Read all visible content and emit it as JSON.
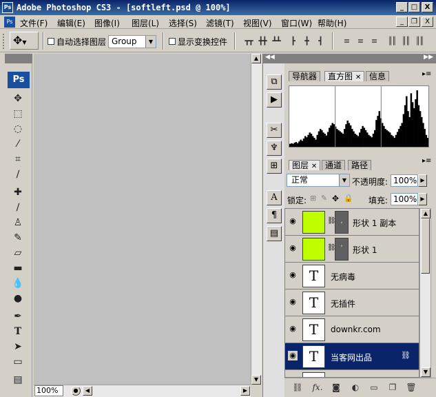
{
  "window": {
    "ps_badge": "Ps",
    "title": "Adobe Photoshop CS3 - [softleft.psd @ 100%]",
    "min_label": "_",
    "max_label": "□",
    "close_label": "X"
  },
  "menu": {
    "items": [
      "文件(F)",
      "编辑(E)",
      "图像(I)",
      "图层(L)",
      "选择(S)",
      "滤镜(T)",
      "视图(V)",
      "窗口(W)",
      "帮助(H)"
    ],
    "doc_min": "_",
    "doc_restore": "❐",
    "doc_close": "X"
  },
  "options": {
    "auto_select_label": "自动选择图层",
    "group_value": "Group",
    "show_transform_label": "显示变换控件"
  },
  "toolbox": {
    "logo": "Ps"
  },
  "document": {
    "zoom": "100%"
  },
  "panels": {
    "top_tabs": [
      "导航器",
      "直方图",
      "信息"
    ],
    "layer_tabs": [
      "图层",
      "通道",
      "路径"
    ],
    "blend_mode": "正常",
    "opacity_label": "不透明度:",
    "opacity_value": "100%",
    "lock_label": "锁定:",
    "fill_label": "填充:",
    "fill_value": "100%",
    "layers": [
      {
        "name": "形状 1 副本",
        "type": "shape",
        "selected": false
      },
      {
        "name": "形状 1",
        "type": "shape",
        "selected": false
      },
      {
        "name": "无病毒",
        "type": "text",
        "selected": false
      },
      {
        "name": "无插件",
        "type": "text",
        "selected": false
      },
      {
        "name": "downkr.com",
        "type": "text",
        "selected": false
      },
      {
        "name": "当客网出品",
        "type": "text",
        "selected": true
      }
    ],
    "text_thumb_glyph": "T"
  },
  "histogram": {
    "bins": [
      5,
      6,
      5,
      7,
      8,
      6,
      9,
      12,
      10,
      14,
      18,
      16,
      20,
      24,
      22,
      18,
      15,
      12,
      20,
      26,
      30,
      28,
      24,
      22,
      19,
      25,
      32,
      36,
      40,
      38,
      34,
      30,
      28,
      26,
      24,
      22,
      30,
      38,
      44,
      40,
      36,
      30,
      26,
      22,
      20,
      18,
      24,
      30,
      35,
      32,
      28,
      24,
      20,
      18,
      16,
      22,
      28,
      45,
      52,
      60,
      48,
      40,
      35,
      30,
      28,
      26,
      24,
      20,
      18,
      15,
      20,
      25,
      30,
      35,
      40,
      55,
      70,
      85,
      60,
      50,
      90,
      75,
      65,
      80,
      95,
      70,
      60,
      50,
      40,
      30,
      20,
      15
    ]
  },
  "colors": {
    "title_blue": "#0a246a",
    "shape_green": "#bfff00",
    "selected_row": "#0a246a",
    "canvas_gray": "#c0c0c0"
  }
}
